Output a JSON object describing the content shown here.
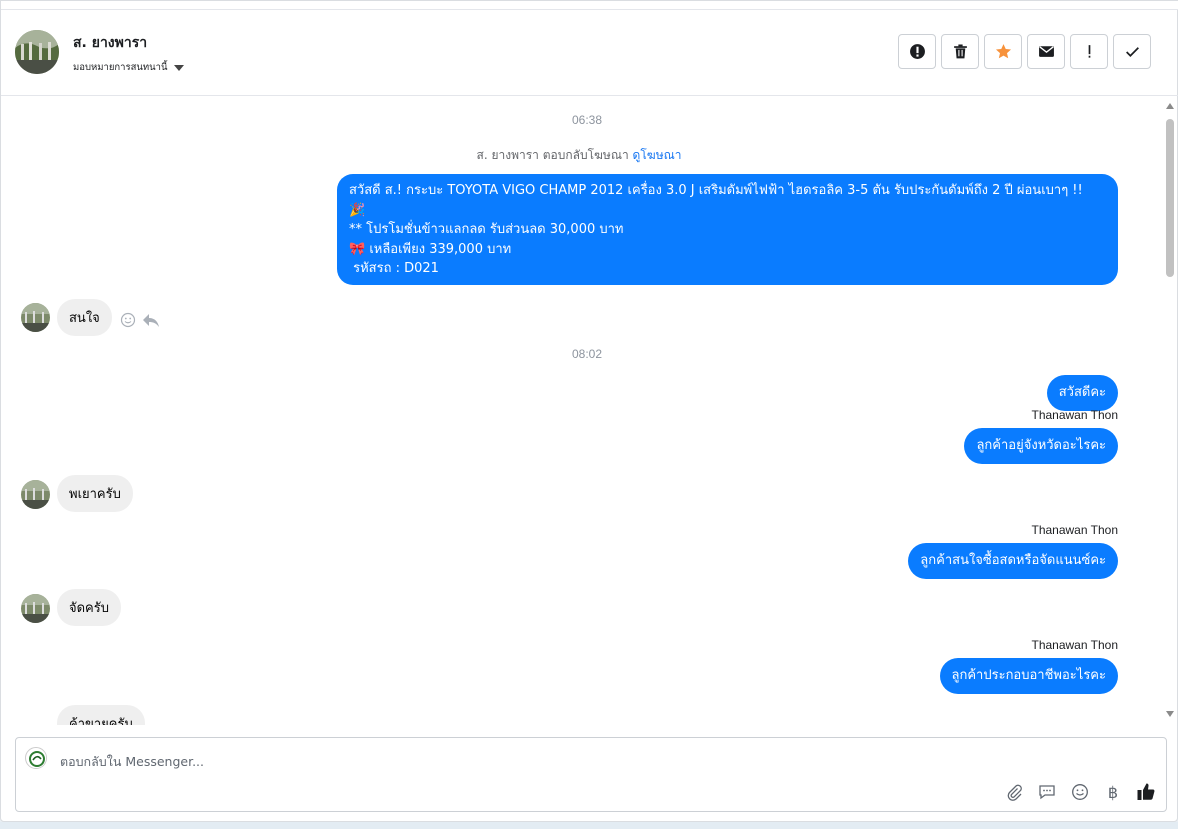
{
  "header": {
    "contact_name": "ส. ยางพารา",
    "assign_label": "มอบหมายการสนทนานี้",
    "actions": [
      {
        "name": "report-spam-button",
        "icon": "exclamation-circle-icon"
      },
      {
        "name": "delete-button",
        "icon": "trash-icon"
      },
      {
        "name": "star-button",
        "icon": "star-icon"
      },
      {
        "name": "mark-unread-button",
        "icon": "envelope-icon"
      },
      {
        "name": "mark-important-button",
        "icon": "exclamation-icon"
      },
      {
        "name": "mark-done-button",
        "icon": "check-icon"
      }
    ]
  },
  "thread": {
    "timestamp_1": "06:38",
    "ad_notice_prefix": "ส. ยางพารา ตอบกลับโฆษณา",
    "ad_notice_link": "ดูโฆษณา",
    "ad_message": {
      "line1": "สวัสดี ส.! กระบะ TOYOTA VIGO CHAMP 2012 เครื่อง 3.0 J เสริมดัมพ์ไฟฟ้า ไฮดรอลิค 3-5 ตัน รับประกันดัมพ์ถึง 2 ปี ผ่อนเบาๆ !!",
      "line2": "🎉",
      "line3": "** โปรโมชั่นข้าวแลกลด รับส่วนลด 30,000 บาท",
      "line4": "🎀 เหลือเพียง 339,000 บาท",
      "line5": " รหัสรถ : D021"
    },
    "in_1": "สนใจ",
    "timestamp_2": "08:02",
    "out_1": "สวัสดีคะ",
    "sender_1": "Thanawan Thon",
    "out_2": "ลูกค้าอยู่จังหวัดอะไรคะ",
    "in_2": "พเยาครับ",
    "sender_2": "Thanawan Thon",
    "out_3": "ลูกค้าสนใจซื้อสดหรือจัดแนนซ์คะ",
    "in_3": "จัดครับ",
    "sender_3": "Thanawan Thon",
    "out_4": "ลูกค้าประกอบอาชีพอะไรคะ",
    "in_4": "ค้าขายครับ"
  },
  "composer": {
    "placeholder": "ตอบกลับใน Messenger...",
    "tools": [
      "paperclip-icon",
      "saved-reply-icon",
      "emoji-icon",
      "baht-icon",
      "thumbs-up-icon"
    ],
    "baht_symbol": "฿"
  },
  "colors": {
    "outgoing_bubble": "#0a7cff",
    "incoming_bubble": "#efefef",
    "star": "#f7923b",
    "link": "#1877f2"
  }
}
